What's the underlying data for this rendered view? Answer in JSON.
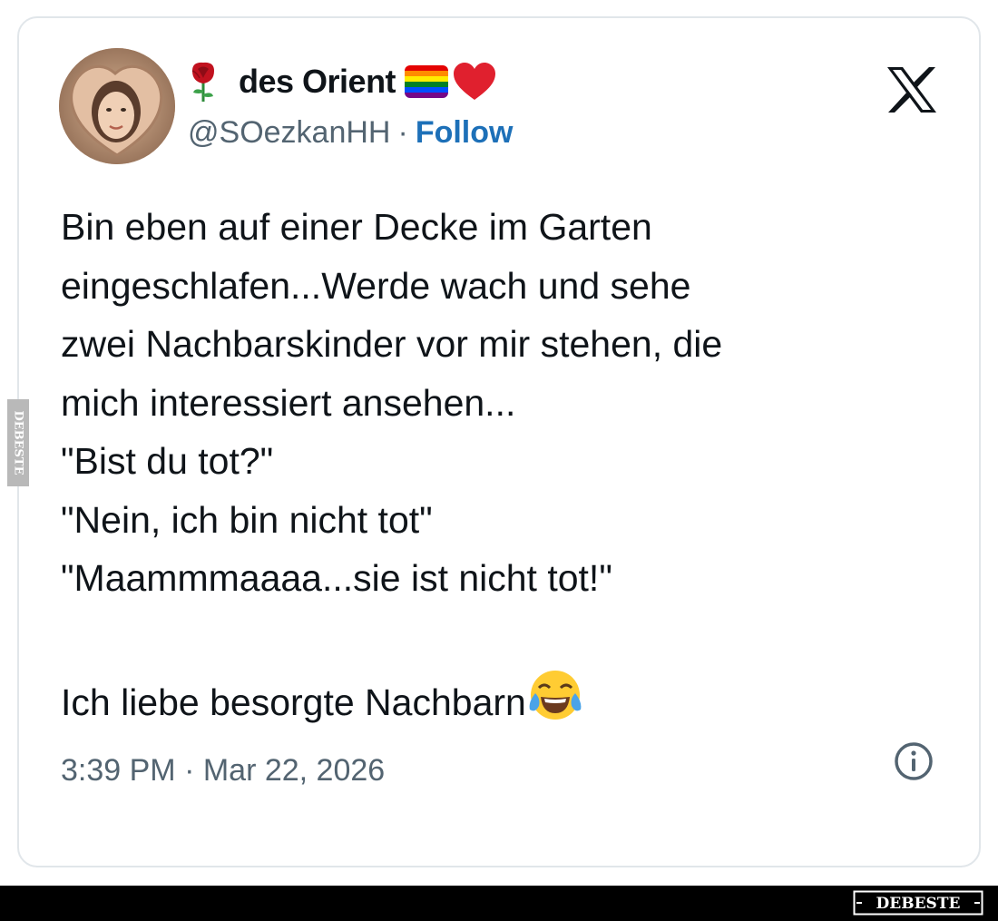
{
  "tweet": {
    "author": {
      "display_name": "des Orient",
      "handle": "@SOezkanHH",
      "separator": "·",
      "follow_label": "Follow",
      "avatar_icon": "avatar-heart-hands-photo",
      "prefix_icon": "rose-icon",
      "suffix_icons": [
        "rainbow-flag-icon",
        "red-heart-icon"
      ]
    },
    "text_lines": [
      "Bin eben auf einer Decke im Garten",
      "eingeschlafen...Werde wach und sehe",
      "zwei Nachbarskinder vor mir stehen, die",
      "mich interessiert ansehen...",
      "\"Bist du tot?\"",
      "\"Nein, ich bin nicht tot\"",
      "\"Maammmaaaa...sie ist nicht tot!\"",
      "",
      "Ich liebe besorgte Nachbarn"
    ],
    "trailing_emoji_icon": "tears-of-joy-icon",
    "timestamp": "3:39 PM · Mar 22, 2026",
    "brand_icon": "x-logo-icon",
    "info_icon": "info-icon"
  },
  "watermark": {
    "logo_text": "DEBESTE"
  },
  "colors": {
    "text": "#0f1419",
    "secondary": "#536471",
    "follow": "#1d70b8",
    "card_border": "#e1e6ea",
    "footer_bg": "#000000"
  }
}
